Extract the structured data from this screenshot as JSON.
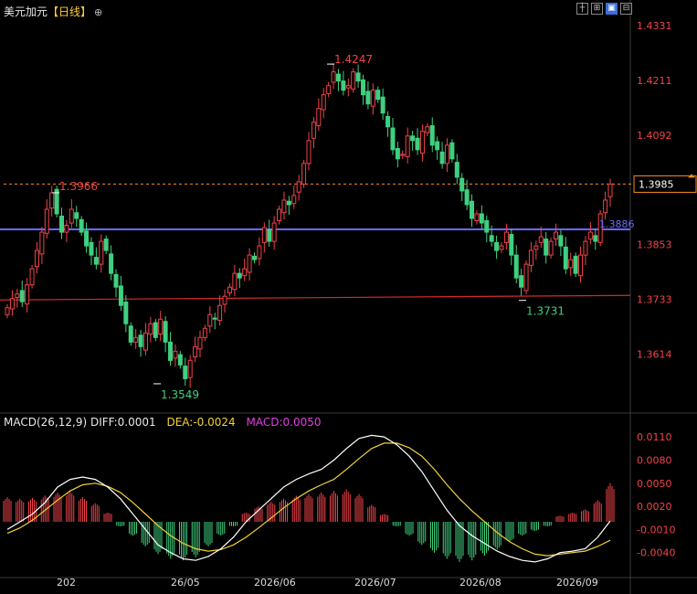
{
  "header": {
    "symbol": "美元加元",
    "interval": "【日线】",
    "settings_icon": "circle-plus-icon"
  },
  "toolbar_icons": [
    "crosshair-icon",
    "grid-icon",
    "minus-icon",
    "chart-icon",
    "plus-icon"
  ],
  "colors": {
    "up": "#f0444a",
    "down": "#3ed07f",
    "axis_text": "#f0444a",
    "hline_blue": "#6b6bff",
    "hline_red": "#d42a2a",
    "price_dash": "#ff8c1a",
    "diff": "#ffffff",
    "dea": "#f0d23a",
    "macd": "#e040e0"
  },
  "chart_data": [
    {
      "type": "candlestick",
      "y_ticks": [
        "1.4331",
        "1.4211",
        "1.4092",
        "1.3853",
        "1.3733",
        "1.3614"
      ],
      "ylim": [
        1.3499,
        1.4343
      ],
      "current_price": "1.3985",
      "current_price_value": 1.3985,
      "support_line_blue": "1.3886",
      "support_line_blue_value": 1.3886,
      "support_line_red_value": 1.3738,
      "annotations": [
        {
          "label": "1.3966",
          "value": 1.3966
        },
        {
          "label": "1.4247",
          "value": 1.4247
        },
        {
          "label": "1.3549",
          "value": 1.3549
        },
        {
          "label": "1.3731",
          "value": 1.3731
        }
      ],
      "x_labels": [
        "202",
        "26/05",
        "2026/06",
        "2026/07",
        "2026/08",
        "2026/09"
      ],
      "closes": [
        1.3715,
        1.3735,
        1.3745,
        1.3728,
        1.3765,
        1.38,
        1.384,
        1.388,
        1.393,
        1.3966,
        1.392,
        1.388,
        1.3895,
        1.393,
        1.391,
        1.388,
        1.385,
        1.383,
        1.381,
        1.386,
        1.384,
        1.379,
        1.376,
        1.372,
        1.368,
        1.364,
        1.365,
        1.363,
        1.366,
        1.368,
        1.365,
        1.369,
        1.364,
        1.36,
        1.362,
        1.359,
        1.356,
        1.36,
        1.363,
        1.365,
        1.367,
        1.37,
        1.369,
        1.372,
        1.374,
        1.376,
        1.379,
        1.378,
        1.38,
        1.383,
        1.382,
        1.385,
        1.389,
        1.386,
        1.39,
        1.393,
        1.395,
        1.394,
        1.396,
        1.399,
        1.403,
        1.408,
        1.412,
        1.415,
        1.418,
        1.42,
        1.423,
        1.421,
        1.419,
        1.42,
        1.423,
        1.421,
        1.418,
        1.416,
        1.419,
        1.417,
        1.414,
        1.411,
        1.406,
        1.404,
        1.405,
        1.409,
        1.408,
        1.406,
        1.41,
        1.411,
        1.407,
        1.406,
        1.403,
        1.407,
        1.404,
        1.4,
        1.397,
        1.394,
        1.391,
        1.392,
        1.39,
        1.388,
        1.386,
        1.384,
        1.385,
        1.388,
        1.383,
        1.378,
        1.376,
        1.381,
        1.384,
        1.385,
        1.387,
        1.383,
        1.386,
        1.388,
        1.385,
        1.38,
        1.382,
        1.379,
        1.383,
        1.386,
        1.388,
        1.386,
        1.392,
        1.395,
        1.3985
      ]
    },
    {
      "type": "macd",
      "title": "MACD(26,12,9)",
      "diff_label": "DIFF:0.0001",
      "dea_label": "DEA:-0.0024",
      "macd_label": "MACD:0.0050",
      "y_ticks": [
        "0.0110",
        "0.0080",
        "0.0050",
        "0.0020",
        "-0.0010",
        "-0.0040"
      ],
      "ylim": [
        -0.0064,
        0.0122
      ],
      "diff": [
        -0.001,
        0.0,
        0.001,
        0.0025,
        0.0045,
        0.0055,
        0.0058,
        0.0055,
        0.0045,
        0.003,
        0.001,
        -0.001,
        -0.003,
        -0.004,
        -0.0048,
        -0.005,
        -0.0045,
        -0.0035,
        -0.002,
        0.0,
        0.0015,
        0.003,
        0.0045,
        0.0055,
        0.0062,
        0.0068,
        0.008,
        0.0095,
        0.0108,
        0.0112,
        0.011,
        0.01,
        0.0085,
        0.0065,
        0.004,
        0.0015,
        -0.0005,
        -0.0018,
        -0.0028,
        -0.0038,
        -0.0045,
        -0.005,
        -0.0052,
        -0.0048,
        -0.004,
        -0.0038,
        -0.0035,
        -0.002,
        0.0001
      ],
      "dea": [
        -0.0015,
        -0.0008,
        0.0002,
        0.0015,
        0.0028,
        0.004,
        0.0048,
        0.005,
        0.0046,
        0.0038,
        0.0025,
        0.001,
        -0.0005,
        -0.0018,
        -0.0028,
        -0.0035,
        -0.0038,
        -0.0036,
        -0.003,
        -0.002,
        -0.0008,
        0.0005,
        0.0018,
        0.003,
        0.004,
        0.0048,
        0.0055,
        0.0068,
        0.0082,
        0.0095,
        0.0102,
        0.0102,
        0.0096,
        0.0085,
        0.0068,
        0.0048,
        0.003,
        0.0014,
        0.0,
        -0.0014,
        -0.0026,
        -0.0035,
        -0.0042,
        -0.0044,
        -0.0042,
        -0.004,
        -0.0038,
        -0.0032,
        -0.0024
      ],
      "hist": [
        0.0032,
        0.003,
        0.0031,
        0.0034,
        0.0038,
        0.004,
        0.0032,
        0.0024,
        0.0012,
        -0.0006,
        -0.0018,
        -0.0032,
        -0.0042,
        -0.0048,
        -0.005,
        -0.0046,
        -0.0032,
        -0.0018,
        -0.0006,
        0.0012,
        0.002,
        0.0026,
        0.003,
        0.0034,
        0.0036,
        0.0038,
        0.004,
        0.0042,
        0.0036,
        0.0022,
        0.001,
        -0.0006,
        -0.0018,
        -0.003,
        -0.004,
        -0.0048,
        -0.0052,
        -0.005,
        -0.0044,
        -0.0036,
        -0.0026,
        -0.0018,
        -0.0012,
        -0.0006,
        0.0008,
        0.0012,
        0.0016,
        0.0028,
        0.005
      ]
    }
  ]
}
